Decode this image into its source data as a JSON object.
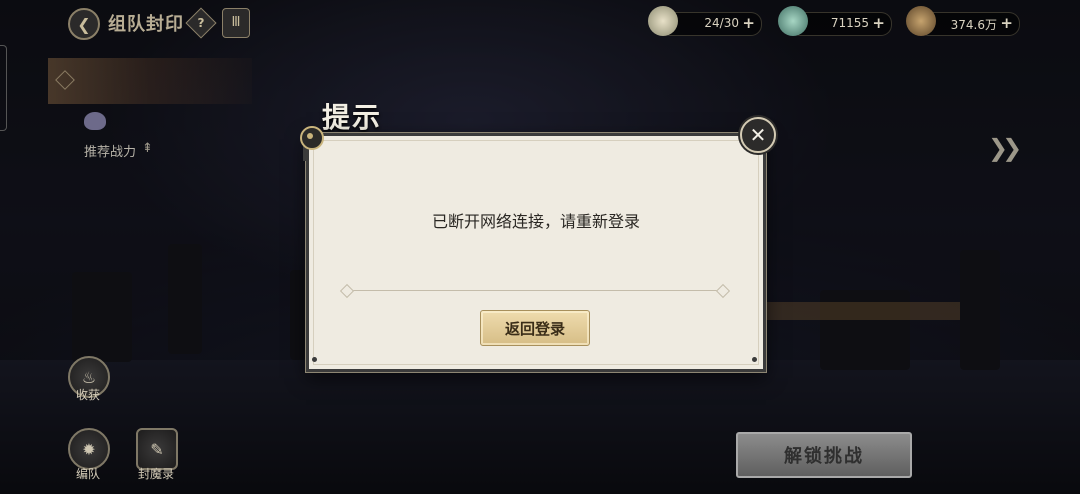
{
  "header": {
    "back_icon": "chevron-left-icon",
    "title": "组队封印",
    "help_label": "?",
    "book_label": "Ⅲ"
  },
  "resources": [
    {
      "name": "stamina",
      "icon": "stamina-icon",
      "value": "24/30",
      "plus": "+"
    },
    {
      "name": "jade",
      "icon": "jade-icon",
      "value": "71155",
      "plus": "+"
    },
    {
      "name": "coins",
      "icon": "coin-icon",
      "value": "374.6万",
      "plus": "+"
    }
  ],
  "left_panel": {
    "recommend_label": "推荐战力",
    "recommend_icon": "power-icon"
  },
  "bottom_left": {
    "harvest_label": "收获",
    "harvest_icon": "pot-icon",
    "team_label": "编队",
    "team_icon": "formation-icon",
    "record_label": "封魔录",
    "record_icon": "scroll-icon"
  },
  "unlock_button": "解锁挑战",
  "dialog": {
    "title": "提示",
    "message": "已断开网络连接，请重新登录",
    "confirm_label": "返回登录",
    "close_label": "✕"
  },
  "colors": {
    "dialog_bg": "#efebe1",
    "confirm_gold": "#d6bd86",
    "accent_frame": "#8b8068"
  }
}
